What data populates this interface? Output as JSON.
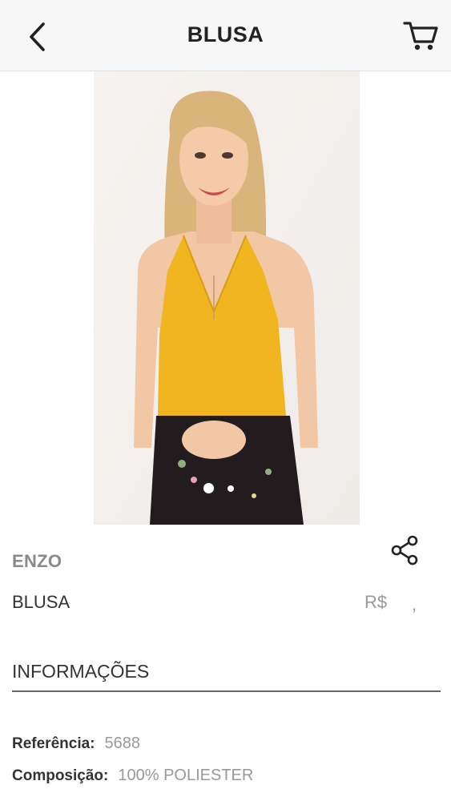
{
  "header": {
    "title": "BLUSA",
    "back_icon": "chevron-left-icon",
    "cart_icon": "shopping-cart-icon"
  },
  "gallery": {
    "image_count": 2,
    "active_index": 0
  },
  "product": {
    "brand": "ENZO",
    "name": "BLUSA",
    "price_currency": "R$",
    "price_separator": ","
  },
  "info": {
    "heading": "INFORMAÇÕES",
    "reference_label": "Referência:",
    "reference_value": "5688",
    "composition_label": "Composição:",
    "composition_value": "100% POLIESTER"
  },
  "colors": {
    "top": "#f0b51f",
    "skirt": "#231c1f",
    "skin": "#f2c7a6",
    "hair": "#d9b57c"
  }
}
